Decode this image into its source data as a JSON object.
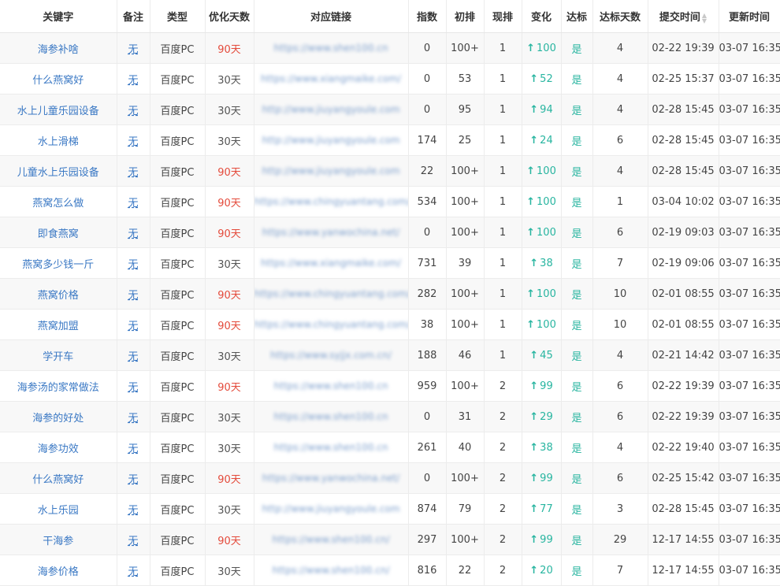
{
  "headers": {
    "keyword": "关键字",
    "note": "备注",
    "type": "类型",
    "opt_days": "优化天数",
    "link": "对应链接",
    "index": "指数",
    "initial_rank": "初排",
    "current_rank": "现排",
    "change": "变化",
    "reached": "达标",
    "reached_days": "达标天数",
    "submit_time": "提交时间",
    "update_time": "更新时间"
  },
  "icons": {
    "change_up": "arrow-up-icon",
    "sort": "sort-icon"
  },
  "colors": {
    "link": "#3a78c4",
    "red_days": "#e44b3c",
    "green": "#28b5a0"
  },
  "rows": [
    {
      "keyword": "海参补啥",
      "note": "无",
      "type": "百度PC",
      "days": "90天",
      "url": "https://www.shen100.cn",
      "index": "0",
      "initial": "100+",
      "current": "1",
      "change": "100",
      "reached": "是",
      "reached_days": "4",
      "submit": "02-22 19:39",
      "update": "03-07 16:35"
    },
    {
      "keyword": "什么燕窝好",
      "note": "无",
      "type": "百度PC",
      "days": "30天",
      "url": "https://www.xiangmaike.com/",
      "index": "0",
      "initial": "53",
      "current": "1",
      "change": "52",
      "reached": "是",
      "reached_days": "4",
      "submit": "02-25 15:37",
      "update": "03-07 16:35"
    },
    {
      "keyword": "水上儿童乐园设备",
      "note": "无",
      "type": "百度PC",
      "days": "30天",
      "url": "http://www.jiuyangyoule.com",
      "index": "0",
      "initial": "95",
      "current": "1",
      "change": "94",
      "reached": "是",
      "reached_days": "4",
      "submit": "02-28 15:45",
      "update": "03-07 16:35"
    },
    {
      "keyword": "水上滑梯",
      "note": "无",
      "type": "百度PC",
      "days": "30天",
      "url": "http://www.jiuyangyoule.com",
      "index": "174",
      "initial": "25",
      "current": "1",
      "change": "24",
      "reached": "是",
      "reached_days": "6",
      "submit": "02-28 15:45",
      "update": "03-07 16:35"
    },
    {
      "keyword": "儿童水上乐园设备",
      "note": "无",
      "type": "百度PC",
      "days": "90天",
      "url": "http://www.jiuyangyoule.com",
      "index": "22",
      "initial": "100+",
      "current": "1",
      "change": "100",
      "reached": "是",
      "reached_days": "4",
      "submit": "02-28 15:45",
      "update": "03-07 16:35"
    },
    {
      "keyword": "燕窝怎么做",
      "note": "无",
      "type": "百度PC",
      "days": "90天",
      "url": "https://www.chingyuantang.com/",
      "index": "534",
      "initial": "100+",
      "current": "1",
      "change": "100",
      "reached": "是",
      "reached_days": "1",
      "submit": "03-04 10:02",
      "update": "03-07 16:35"
    },
    {
      "keyword": "即食燕窝",
      "note": "无",
      "type": "百度PC",
      "days": "90天",
      "url": "https://www.yanwochina.net/",
      "index": "0",
      "initial": "100+",
      "current": "1",
      "change": "100",
      "reached": "是",
      "reached_days": "6",
      "submit": "02-19 09:03",
      "update": "03-07 16:35"
    },
    {
      "keyword": "燕窝多少钱一斤",
      "note": "无",
      "type": "百度PC",
      "days": "30天",
      "url": "https://www.xiangmaike.com/",
      "index": "731",
      "initial": "39",
      "current": "1",
      "change": "38",
      "reached": "是",
      "reached_days": "7",
      "submit": "02-19 09:06",
      "update": "03-07 16:35"
    },
    {
      "keyword": "燕窝价格",
      "note": "无",
      "type": "百度PC",
      "days": "90天",
      "url": "https://www.chingyuantang.com/",
      "index": "282",
      "initial": "100+",
      "current": "1",
      "change": "100",
      "reached": "是",
      "reached_days": "10",
      "submit": "02-01 08:55",
      "update": "03-07 16:35"
    },
    {
      "keyword": "燕窝加盟",
      "note": "无",
      "type": "百度PC",
      "days": "90天",
      "url": "https://www.chingyuantang.com/",
      "index": "38",
      "initial": "100+",
      "current": "1",
      "change": "100",
      "reached": "是",
      "reached_days": "10",
      "submit": "02-01 08:55",
      "update": "03-07 16:35"
    },
    {
      "keyword": "学开车",
      "note": "无",
      "type": "百度PC",
      "days": "30天",
      "url": "https://www.syjjx.com.cn/",
      "index": "188",
      "initial": "46",
      "current": "1",
      "change": "45",
      "reached": "是",
      "reached_days": "4",
      "submit": "02-21 14:42",
      "update": "03-07 16:35"
    },
    {
      "keyword": "海参汤的家常做法",
      "note": "无",
      "type": "百度PC",
      "days": "90天",
      "url": "https://www.shen100.cn",
      "index": "959",
      "initial": "100+",
      "current": "2",
      "change": "99",
      "reached": "是",
      "reached_days": "6",
      "submit": "02-22 19:39",
      "update": "03-07 16:35"
    },
    {
      "keyword": "海参的好处",
      "note": "无",
      "type": "百度PC",
      "days": "30天",
      "url": "https://www.shen100.cn",
      "index": "0",
      "initial": "31",
      "current": "2",
      "change": "29",
      "reached": "是",
      "reached_days": "6",
      "submit": "02-22 19:39",
      "update": "03-07 16:35"
    },
    {
      "keyword": "海参功效",
      "note": "无",
      "type": "百度PC",
      "days": "30天",
      "url": "https://www.shen100.cn",
      "index": "261",
      "initial": "40",
      "current": "2",
      "change": "38",
      "reached": "是",
      "reached_days": "4",
      "submit": "02-22 19:40",
      "update": "03-07 16:35"
    },
    {
      "keyword": "什么燕窝好",
      "note": "无",
      "type": "百度PC",
      "days": "90天",
      "url": "https://www.yanwochina.net/",
      "index": "0",
      "initial": "100+",
      "current": "2",
      "change": "99",
      "reached": "是",
      "reached_days": "6",
      "submit": "02-25 15:42",
      "update": "03-07 16:35"
    },
    {
      "keyword": "水上乐园",
      "note": "无",
      "type": "百度PC",
      "days": "30天",
      "url": "http://www.jiuyangyoule.com",
      "index": "874",
      "initial": "79",
      "current": "2",
      "change": "77",
      "reached": "是",
      "reached_days": "3",
      "submit": "02-28 15:45",
      "update": "03-07 16:35"
    },
    {
      "keyword": "干海参",
      "note": "无",
      "type": "百度PC",
      "days": "90天",
      "url": "https://www.shen100.cn/",
      "index": "297",
      "initial": "100+",
      "current": "2",
      "change": "99",
      "reached": "是",
      "reached_days": "29",
      "submit": "12-17 14:55",
      "update": "03-07 16:35"
    },
    {
      "keyword": "海参价格",
      "note": "无",
      "type": "百度PC",
      "days": "30天",
      "url": "https://www.shen100.cn/",
      "index": "816",
      "initial": "22",
      "current": "2",
      "change": "20",
      "reached": "是",
      "reached_days": "7",
      "submit": "12-17 14:55",
      "update": "03-07 16:35"
    }
  ]
}
